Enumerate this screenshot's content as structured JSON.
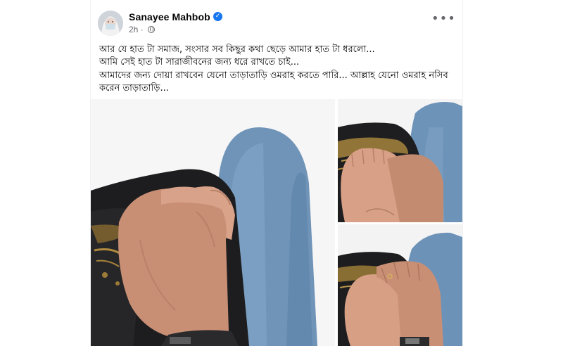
{
  "post": {
    "author": "Sanayee Mahbob",
    "time": "2h",
    "separator": "·",
    "more_icon": "•••",
    "text_lines": [
      "আর যে হাত টা সমাজ, সংসার সব কিছুর কথা ছেড়ে আমার হাত টা ধরলো...",
      "আমি সেই হাত টা সারাজীবনের জন্য ধরে রাখতে চাই...",
      "আমাদের জন্য দোয়া রাখবেন যেনো তাড়াতাড়ি ওমরাহ করতে পারি... আল্লাহ যেনো ওমরাহ নসিব করেন তাড়াতাড়ি..."
    ]
  },
  "icons": {
    "verified": "verified-badge-icon",
    "privacy": "globe-icon",
    "menu": "more-options-icon"
  },
  "colors": {
    "verified": "#1877f2",
    "name": "#050505",
    "meta": "#65676b"
  }
}
